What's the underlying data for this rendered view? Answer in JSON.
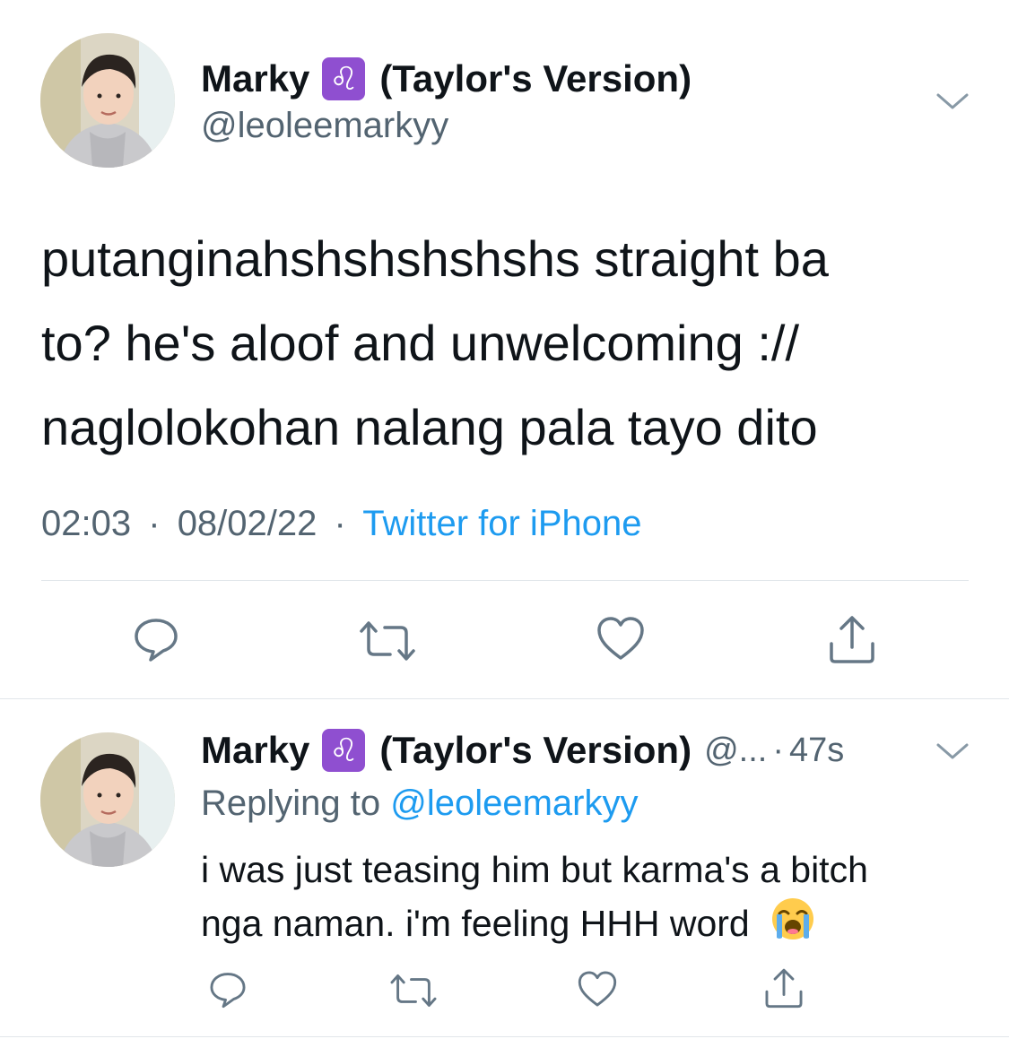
{
  "main_tweet": {
    "author": {
      "name": "Marky",
      "zodiac_glyph": "♌",
      "name_suffix": "(Taylor's Version)",
      "handle": "@leoleemarkyy"
    },
    "text_lines": [
      "putanginahshshshshshs straight ba",
      "to? he's aloof and unwelcoming ://",
      "naglolokohan nalang pala tayo dito"
    ],
    "time": "02:03",
    "separator": "·",
    "date": "08/02/22",
    "source": "Twitter for iPhone",
    "actions": {
      "reply_icon": "reply-icon",
      "retweet_icon": "retweet-icon",
      "like_icon": "heart-icon",
      "share_icon": "share-icon"
    }
  },
  "reply_tweet": {
    "author": {
      "name": "Marky",
      "zodiac_glyph": "♌",
      "name_suffix": "(Taylor's Version)",
      "handle_truncated": "@...",
      "time": "47s"
    },
    "separator": "·",
    "replying_prefix": "Replying to",
    "replying_to": "@leoleemarkyy",
    "text_lines": [
      "i was just teasing him but karma's a bitch",
      "nga naman. i'm feeling HHH word"
    ],
    "emoji": "loudly-crying-face"
  },
  "colors": {
    "accent": "#1d9bf0",
    "leo_badge": "#8f4fd0",
    "text": "#0f1419",
    "muted": "#536471",
    "divider": "#e1e6ea"
  }
}
